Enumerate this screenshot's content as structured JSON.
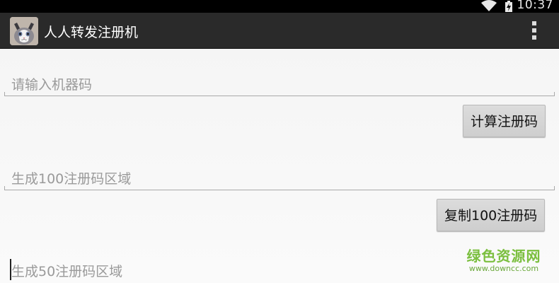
{
  "status_bar": {
    "time": "10:37",
    "icons": [
      "wifi-icon",
      "battery-charging-icon"
    ]
  },
  "action_bar": {
    "icon": "cat-app-icon",
    "title": "人人转发注册机",
    "overflow_icon": "overflow-menu-icon"
  },
  "machine_code_input": {
    "placeholder": "请输入机器码",
    "value": ""
  },
  "compute_button": {
    "label": "计算注册码"
  },
  "codes_100_field": {
    "placeholder": "生成100注册码区域",
    "value": ""
  },
  "copy_100_button": {
    "label": "复制100注册码"
  },
  "codes_50_field": {
    "placeholder": "生成50注册码区域",
    "value": ""
  },
  "watermark": {
    "name": "绿色资源网",
    "url": "www.downcc.com"
  },
  "colors": {
    "action_bar_bg": "#2a2a2a",
    "status_bar_bg": "#000000",
    "hint_text": "#9a9a9a",
    "watermark_green": "#7bbf3f"
  }
}
